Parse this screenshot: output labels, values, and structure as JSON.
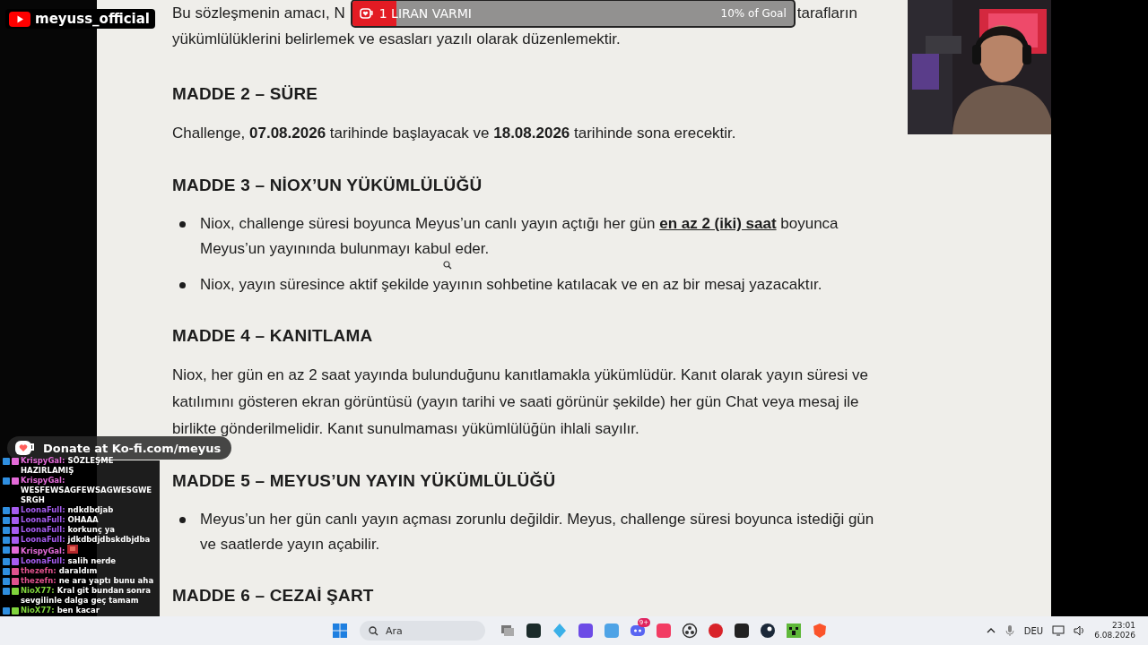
{
  "stream_label": {
    "name": "meyuss_official"
  },
  "goal": {
    "title": "1 LIRAN VARMI",
    "progress_text": "10% of Goal",
    "level": 0.1
  },
  "document": {
    "intro": {
      "before": "Bu sözleşmenin amacı, N",
      "after": "tarafların",
      "line2": "yükümlülüklerini belirlemek ve esasları yazılı olarak düzenlemektir."
    },
    "sections": [
      {
        "heading": "MADDE 2 – SÜRE",
        "blocks": [
          {
            "kind": "paragraph",
            "text": "Challenge, **07.08.2026** tarihinde başlayacak ve **18.08.2026** tarihinde sona erecektir."
          }
        ]
      },
      {
        "heading": "MADDE 3 – NİOX’UN YÜKÜMLÜLÜĞÜ",
        "blocks": [
          {
            "kind": "bullet",
            "text": "Niox, challenge süresi boyunca Meyus’un canlı yayın açtığı her gün **en az 2 (iki) saat** boyunca Meyus’un yayınında bulunmayı kabul eder."
          },
          {
            "kind": "bullet",
            "text": "Niox, yayın süresince aktif şekilde yayının sohbetine katılacak ve en az bir mesaj yazacaktır."
          }
        ]
      },
      {
        "heading": "MADDE 4 – KANITLAMA",
        "blocks": [
          {
            "kind": "paragraph",
            "text": "Niox, her gün en az 2 saat yayında bulunduğunu kanıtlamakla yükümlüdür. Kanıt olarak yayın süresi ve katılımını gösteren ekran görüntüsü (yayın tarihi ve saati görünür şekilde) her gün Chat veya mesaj ile birlikte gönderilmelidir. Kanıt sunulmaması yükümlülüğün ihlali sayılır."
          }
        ]
      },
      {
        "heading": "MADDE 5 – MEYUS’UN YAYIN YÜKÜMLÜLÜĞÜ",
        "blocks": [
          {
            "kind": "bullet",
            "text": "Meyus’un her gün canlı yayın açması zorunlu değildir. Meyus, challenge süresi boyunca istediği gün ve saatlerde yayın açabilir."
          }
        ]
      },
      {
        "heading": "MADDE 6 – CEZAİ ŞART"
      }
    ]
  },
  "donate": {
    "text": "Donate at Ko-fi.com/meyus"
  },
  "chat_separator": ":",
  "chat": [
    {
      "user": "KrispyGal",
      "color": "#e36ad8",
      "kind": "text",
      "text": "SÖZLEŞME HAZIRLAMIŞ"
    },
    {
      "user": "KrispyGal",
      "color": "#e36ad8",
      "kind": "text",
      "text": "WESFEWSAGFEWSAGWESGWESRGH"
    },
    {
      "user": "LoonaFull",
      "color": "#a65cf0",
      "kind": "text",
      "text": "ndkdbdjab"
    },
    {
      "user": "LoonaFull",
      "color": "#a65cf0",
      "kind": "text",
      "text": "OHAAA"
    },
    {
      "user": "LoonaFull",
      "color": "#a65cf0",
      "kind": "text",
      "text": "korkunç ya"
    },
    {
      "user": "LoonaFull",
      "color": "#a65cf0",
      "kind": "text",
      "text": "jdkdbdjdbskdbjdba"
    },
    {
      "user": "KrispyGal",
      "color": "#e36ad8",
      "kind": "emote"
    },
    {
      "user": "LoonaFull",
      "color": "#a65cf0",
      "kind": "text",
      "text": "salih nerde"
    },
    {
      "user": "thezefn",
      "color": "#e0528e",
      "kind": "text",
      "text": "daraldım"
    },
    {
      "user": "thezefn",
      "color": "#e0528e",
      "kind": "text",
      "text": "ne ara yaptı bunu aha"
    },
    {
      "user": "NioX77",
      "color": "#7fd43c",
      "kind": "text",
      "text": "Kral git bundan sonra sevgilinle dalga geç tamam"
    },
    {
      "user": "NioX77",
      "color": "#7fd43c",
      "kind": "text",
      "text": "ben kacar"
    }
  ],
  "taskbar": {
    "search_placeholder": "Ara",
    "notification_badge": "9+",
    "language": "DEU",
    "time": "23:01",
    "date": "6.08.2026"
  }
}
